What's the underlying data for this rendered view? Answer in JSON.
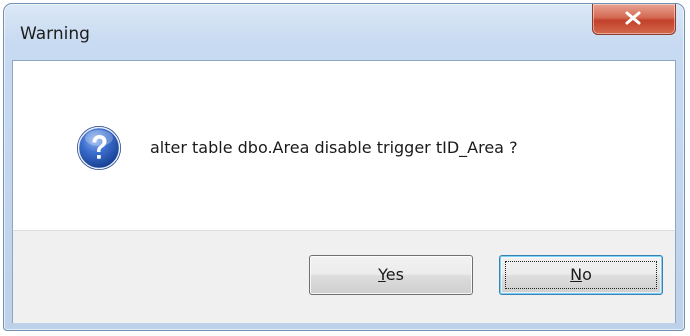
{
  "window": {
    "title": "Warning"
  },
  "icons": {
    "close": "close-icon",
    "question": "question-icon"
  },
  "colors": {
    "question_icon": "#2b59b0",
    "close_button": "#c9472f"
  },
  "message": {
    "text": "alter table dbo.Area disable trigger tID_Area ?"
  },
  "buttons": {
    "yes": {
      "mnemonic": "Y",
      "rest": "es"
    },
    "no": {
      "mnemonic": "N",
      "rest": "o"
    }
  }
}
